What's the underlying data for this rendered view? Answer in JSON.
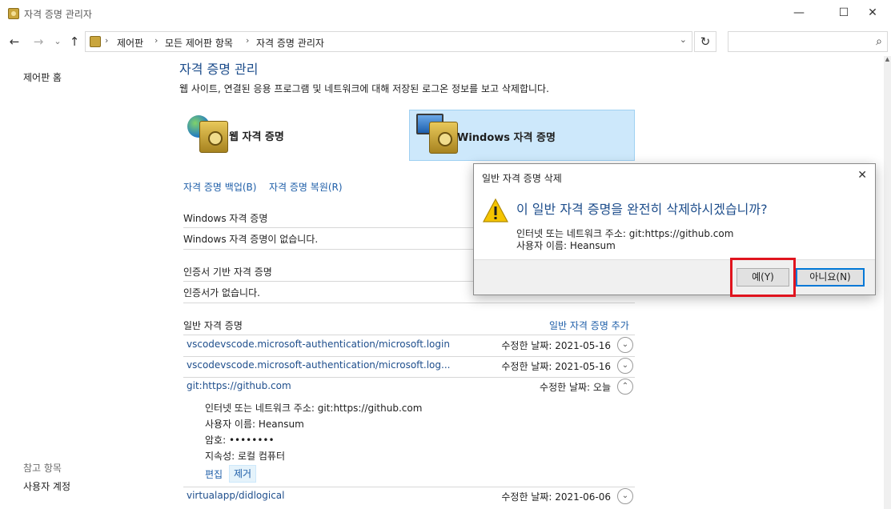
{
  "window": {
    "title": "자격 증명 관리자",
    "controls": {
      "minimize": "—",
      "maximize": "☐",
      "close": "✕"
    }
  },
  "nav": {
    "back": "←",
    "forward": "→",
    "recent": "⌄",
    "up": "↑",
    "breadcrumb": [
      "제어판",
      "모든 제어판 항목",
      "자격 증명 관리자"
    ],
    "separator": "›",
    "dropdown": "⌄",
    "refresh": "↻",
    "search_placeholder": "",
    "search_icon": "⌕"
  },
  "sidebar": {
    "home": "제어판 홈",
    "see_also": "참고 항목",
    "user_accounts": "사용자 계정"
  },
  "main": {
    "title": "자격 증명 관리",
    "description": "웹 사이트, 연결된 응용 프로그램 및 네트워크에 대해 저장된 로그온 정보를 보고 삭제합니다.",
    "tiles": {
      "web": "웹 자격 증명",
      "windows": "Windows 자격 증명"
    },
    "backup_link": "자격 증명 백업(B)",
    "restore_link": "자격 증명 복원(R)",
    "windows_section": {
      "heading": "Windows 자격 증명",
      "empty": "Windows 자격 증명이 없습니다."
    },
    "cert_section": {
      "heading": "인증서 기반 자격 증명",
      "empty": "인증서가 없습니다."
    },
    "generic_section": {
      "heading": "일반 자격 증명",
      "add_link": "일반 자격 증명 추가",
      "items": [
        {
          "name": "vscodevscode.microsoft-authentication/microsoft.login",
          "modified": "수정한 날짜:  2021-05-16",
          "chevron": "⌄"
        },
        {
          "name": "vscodevscode.microsoft-authentication/microsoft.log...",
          "modified": "수정한 날짜:  2021-05-16",
          "chevron": "⌄"
        },
        {
          "name": "git:https://github.com",
          "modified": "수정한 날짜:  오늘",
          "chevron": "⌃"
        },
        {
          "name": "virtualapp/didlogical",
          "modified": "수정한 날짜:  2021-06-06",
          "chevron": "⌄"
        }
      ],
      "expanded": {
        "address": "인터넷 또는 네트워크 주소:  git:https://github.com",
        "username": "사용자 이름:  Heansum",
        "password": "암호:  ••••••••",
        "persistence": "지속성:  로컬 컴퓨터",
        "edit": "편집",
        "remove": "제거"
      }
    }
  },
  "dialog": {
    "title": "일반 자격 증명 삭제",
    "close": "✕",
    "question": "이 일반 자격 증명을 완전히 삭제하시겠습니까?",
    "address_line": "인터넷 또는 네트워크 주소: git:https://github.com",
    "username_line": "사용자 이름: Heansum",
    "yes_button": "예(Y)",
    "no_button": "아니요(N)"
  },
  "colors": {
    "accent": "#0078d7",
    "highlight": "#e0141e",
    "link": "#1e5ea8",
    "tile_selected": "#cde8fb"
  }
}
